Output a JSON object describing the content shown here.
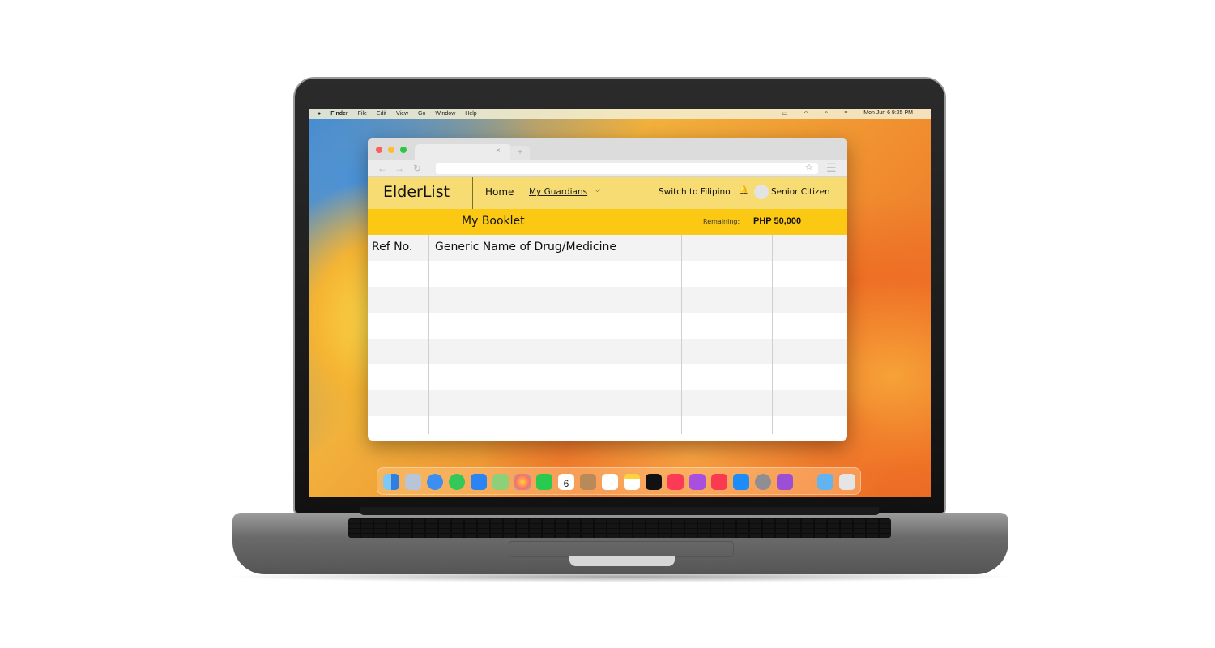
{
  "menubar": {
    "apple": "",
    "app": "Finder",
    "items": [
      "File",
      "Edit",
      "View",
      "Go",
      "Window",
      "Help"
    ],
    "clock": "Mon Jun 6  9:25 PM"
  },
  "browser": {
    "tab_close": "×",
    "tab_new": "+",
    "back": "←",
    "forward": "→",
    "reload": "↻",
    "star": "☆",
    "menu": "☰"
  },
  "header": {
    "logo": "ElderList",
    "nav_home": "Home",
    "nav_guardians": "My Guardians",
    "chevron": "⌵",
    "switch_lang": "Switch to Filipino",
    "bell": "🔔",
    "user_role": "Senior Citizen"
  },
  "subheader": {
    "title": "My Booklet",
    "remaining_label": "Remaining:",
    "remaining_value": "PHP 50,000"
  },
  "table": {
    "headers": [
      "Ref No.",
      "Generic Name of Drug/Medicine",
      "",
      ""
    ],
    "rows": [
      [],
      [],
      [],
      [],
      [],
      [],
      []
    ]
  },
  "dock": {
    "calendar_day": "6",
    "apps": [
      "finder-icon",
      "launchpad-icon",
      "safari-icon",
      "messages-icon",
      "mail-icon",
      "maps-icon",
      "photos-icon",
      "facetime-icon",
      "calendar-icon",
      "contacts-icon",
      "reminders-icon",
      "notes-icon",
      "tv-icon",
      "music-icon",
      "podcasts-icon",
      "news-icon",
      "appstore-icon",
      "settings-icon",
      "feedback-icon",
      "downloads-icon",
      "trash-icon"
    ]
  },
  "colors": {
    "appbar": "#f6dc72",
    "subbar": "#fbc913"
  }
}
